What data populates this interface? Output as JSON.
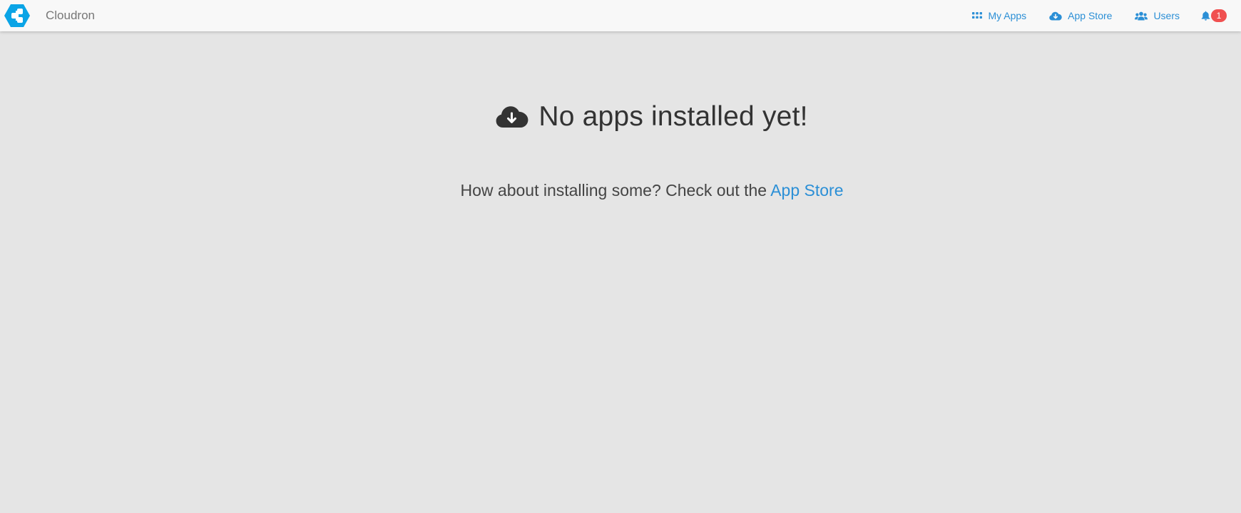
{
  "header": {
    "brand_name": "Cloudron",
    "logo_icon": "cloudron-hexagon-logo",
    "nav": [
      {
        "label": "My Apps",
        "icon": "grid-icon"
      },
      {
        "label": "App Store",
        "icon": "cloud-download-icon"
      },
      {
        "label": "Users",
        "icon": "users-icon"
      }
    ],
    "notifications": {
      "icon": "bell-icon",
      "count": "1"
    }
  },
  "empty_state": {
    "icon": "cloud-download-icon",
    "title": "No apps installed yet!",
    "message": "How about installing some? Check out the",
    "link_label": "App Store"
  },
  "colors": {
    "accent": "#2b8fd6",
    "logo": "#0aa4e6",
    "badge": "#f05050",
    "navbar_bg": "#f8f8f8",
    "page_bg": "#e5e5e5"
  }
}
